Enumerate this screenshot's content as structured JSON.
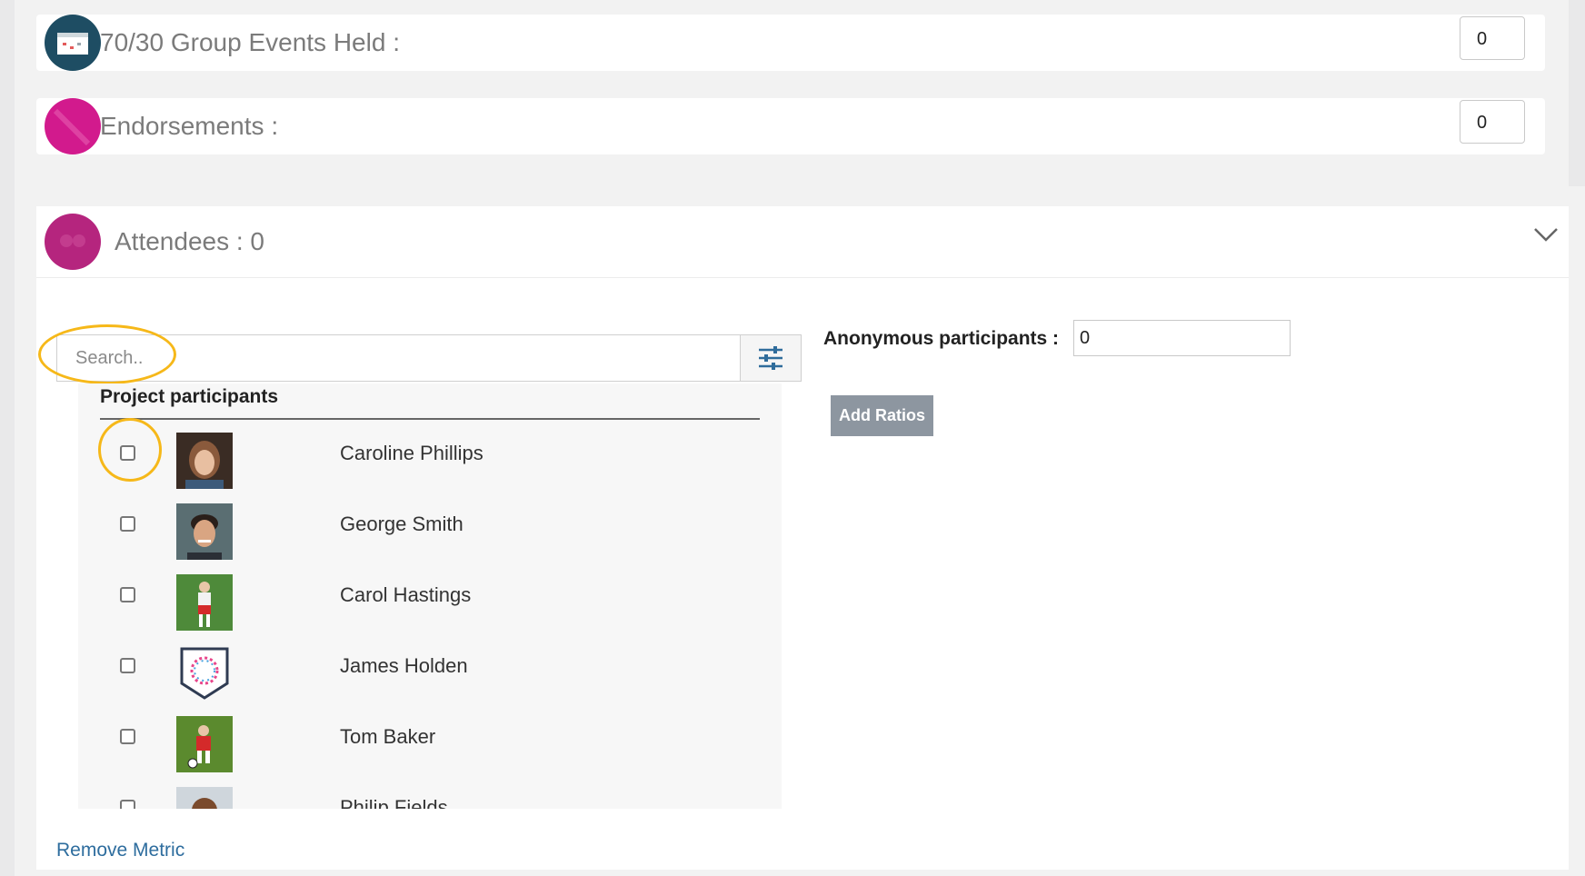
{
  "metrics": [
    {
      "label": "70/30 Group Events Held :",
      "value": "0",
      "icon": "calendar-icon",
      "color": "#1e4d63"
    },
    {
      "label": "Endorsements :",
      "value": "0",
      "icon": "endorsement-icon",
      "color": "#d21a8d"
    }
  ],
  "attendees": {
    "title": "Attendees : 0",
    "icon": "attendees-icon",
    "color": "#b5257e",
    "search_placeholder": "Search..",
    "list_header": "Project participants",
    "participants": [
      {
        "name": "Caroline Phillips"
      },
      {
        "name": "George Smith"
      },
      {
        "name": "Carol Hastings"
      },
      {
        "name": "James Holden"
      },
      {
        "name": "Tom Baker"
      },
      {
        "name": "Philip Fields"
      }
    ],
    "anonymous_label": "Anonymous participants :",
    "anonymous_value": "0",
    "add_ratios_label": "Add Ratios",
    "remove_metric_label": "Remove Metric"
  },
  "colors": {
    "highlight": "#f6b819",
    "link": "#2e6d9e",
    "button": "#8d96a0"
  }
}
